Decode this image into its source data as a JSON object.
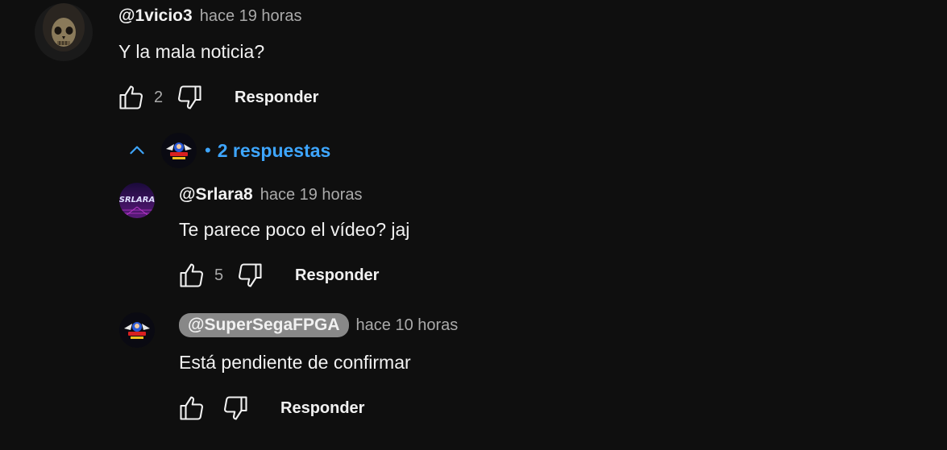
{
  "comments": [
    {
      "author": "@1vicio3",
      "time": "hace 19 horas",
      "text": "Y la mala noticia?",
      "likes": "2",
      "reply_label": "Responder"
    }
  ],
  "replies_toggle": {
    "dot": "•",
    "label": "2 respuestas"
  },
  "replies": [
    {
      "author": "@Srlara8",
      "time": "hace 19 horas",
      "text": "Te parece poco el vídeo? jaj",
      "likes": "5",
      "reply_label": "Responder"
    },
    {
      "author": "@SuperSegaFPGA",
      "time": "hace 10 horas",
      "text": "Está pendiente de confirmar",
      "likes": "",
      "reply_label": "Responder"
    }
  ],
  "colors": {
    "background": "#0f0f0f",
    "primary_text": "#f1f1f1",
    "secondary_text": "#aaaaaa",
    "link_blue": "#3ea6ff",
    "owner_badge": "#888888"
  }
}
